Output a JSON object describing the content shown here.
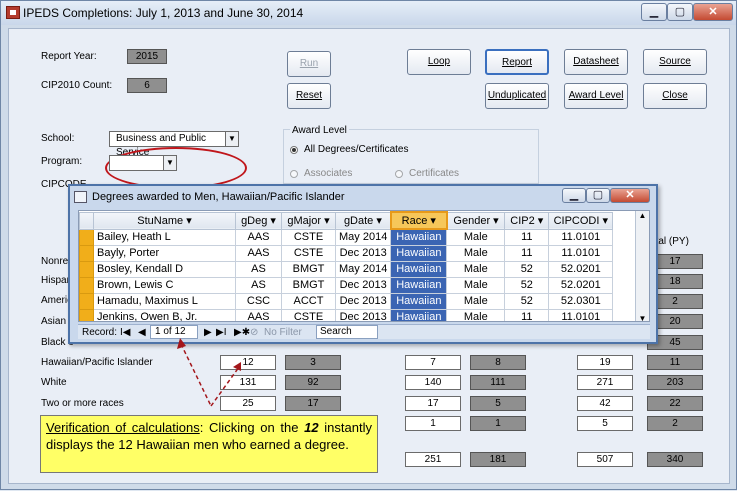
{
  "window": {
    "title": "IPEDS Completions:  July 1, 2013 and June 30, 2014"
  },
  "report": {
    "report_year_label": "Report Year:",
    "report_year": "2015",
    "cip_count_label": "CIP2010 Count:",
    "cip_count": "6",
    "school_label": "School:",
    "school_value": "Business and Public Service",
    "program_label": "Program:",
    "cipcode_label": "CIPCODE"
  },
  "buttons": {
    "run": "Run",
    "reset": "Reset",
    "loop": "Loop",
    "report": "Report",
    "datasheet": "Datasheet",
    "source": "Source",
    "unduplicated": "Unduplicated",
    "award_level": "Award Level",
    "close": "Close"
  },
  "award_level": {
    "title": "Award Level",
    "options": [
      "All Degrees/Certificates",
      "Associates",
      "Certificates"
    ],
    "selected": "All Degrees/Certificates"
  },
  "popup": {
    "title": "Degrees awarded to Men, Hawaiian/Pacific Islander",
    "columns": [
      "StuName",
      "gDeg",
      "gMajor",
      "gDate",
      "Race",
      "Gender",
      "CIP2",
      "CIPCODI"
    ],
    "rows": [
      [
        "Bailey, Heath L",
        "AAS",
        "CSTE",
        "May 2014",
        "Hawaiian",
        "Male",
        "11",
        "11.0101"
      ],
      [
        "Bayly, Porter",
        "AAS",
        "CSTE",
        "Dec 2013",
        "Hawaiian",
        "Male",
        "11",
        "11.0101"
      ],
      [
        "Bosley, Kendall D",
        "AS",
        "BMGT",
        "May 2014",
        "Hawaiian",
        "Male",
        "52",
        "52.0201"
      ],
      [
        "Brown, Lewis C",
        "AS",
        "BMGT",
        "Dec 2013",
        "Hawaiian",
        "Male",
        "52",
        "52.0201"
      ],
      [
        "Hamadu, Maximus L",
        "CSC",
        "ACCT",
        "Dec 2013",
        "Hawaiian",
        "Male",
        "52",
        "52.0301"
      ],
      [
        "Jenkins, Owen B, Jr.",
        "AAS",
        "CSTE",
        "Dec 2013",
        "Hawaiian",
        "Male",
        "11",
        "11.0101"
      ]
    ],
    "nav": {
      "record_label": "Record:",
      "position": "1 of 12",
      "filter": "No Filter",
      "search": "Search"
    }
  },
  "ethnicity_rows": {
    "partial_labels": [
      "Nonres",
      "Hispan",
      "Americ",
      "Asian",
      "Black o"
    ],
    "col_header": "otal (PY)",
    "right_values": [
      "17",
      "18",
      "2",
      "20",
      "45"
    ],
    "rows": [
      {
        "label": "Hawaiian/Pacific Islander",
        "values": [
          "12",
          "3",
          "7",
          "8",
          "19",
          "11"
        ]
      },
      {
        "label": "White",
        "values": [
          "131",
          "92",
          "140",
          "111",
          "271",
          "203"
        ]
      },
      {
        "label": "Two or more races",
        "values": [
          "25",
          "17",
          "17",
          "5",
          "42",
          "22"
        ]
      },
      {
        "label": "",
        "values": [
          "",
          "",
          "1",
          "1",
          "5",
          "2"
        ]
      }
    ],
    "totals": [
      "251",
      "181",
      "507",
      "340"
    ]
  },
  "callout": {
    "link_text": "Verification of calculations",
    "text_a": ": Clicking on the ",
    "emph": "12",
    "text_b": " instantly displays the 12 Hawaiian men who earned a degree."
  },
  "colors": {
    "highlight": "#f1ae1a",
    "selected_cell": "#3b65b3",
    "callout": "#ffff66",
    "ellipse": "#c0161b"
  }
}
